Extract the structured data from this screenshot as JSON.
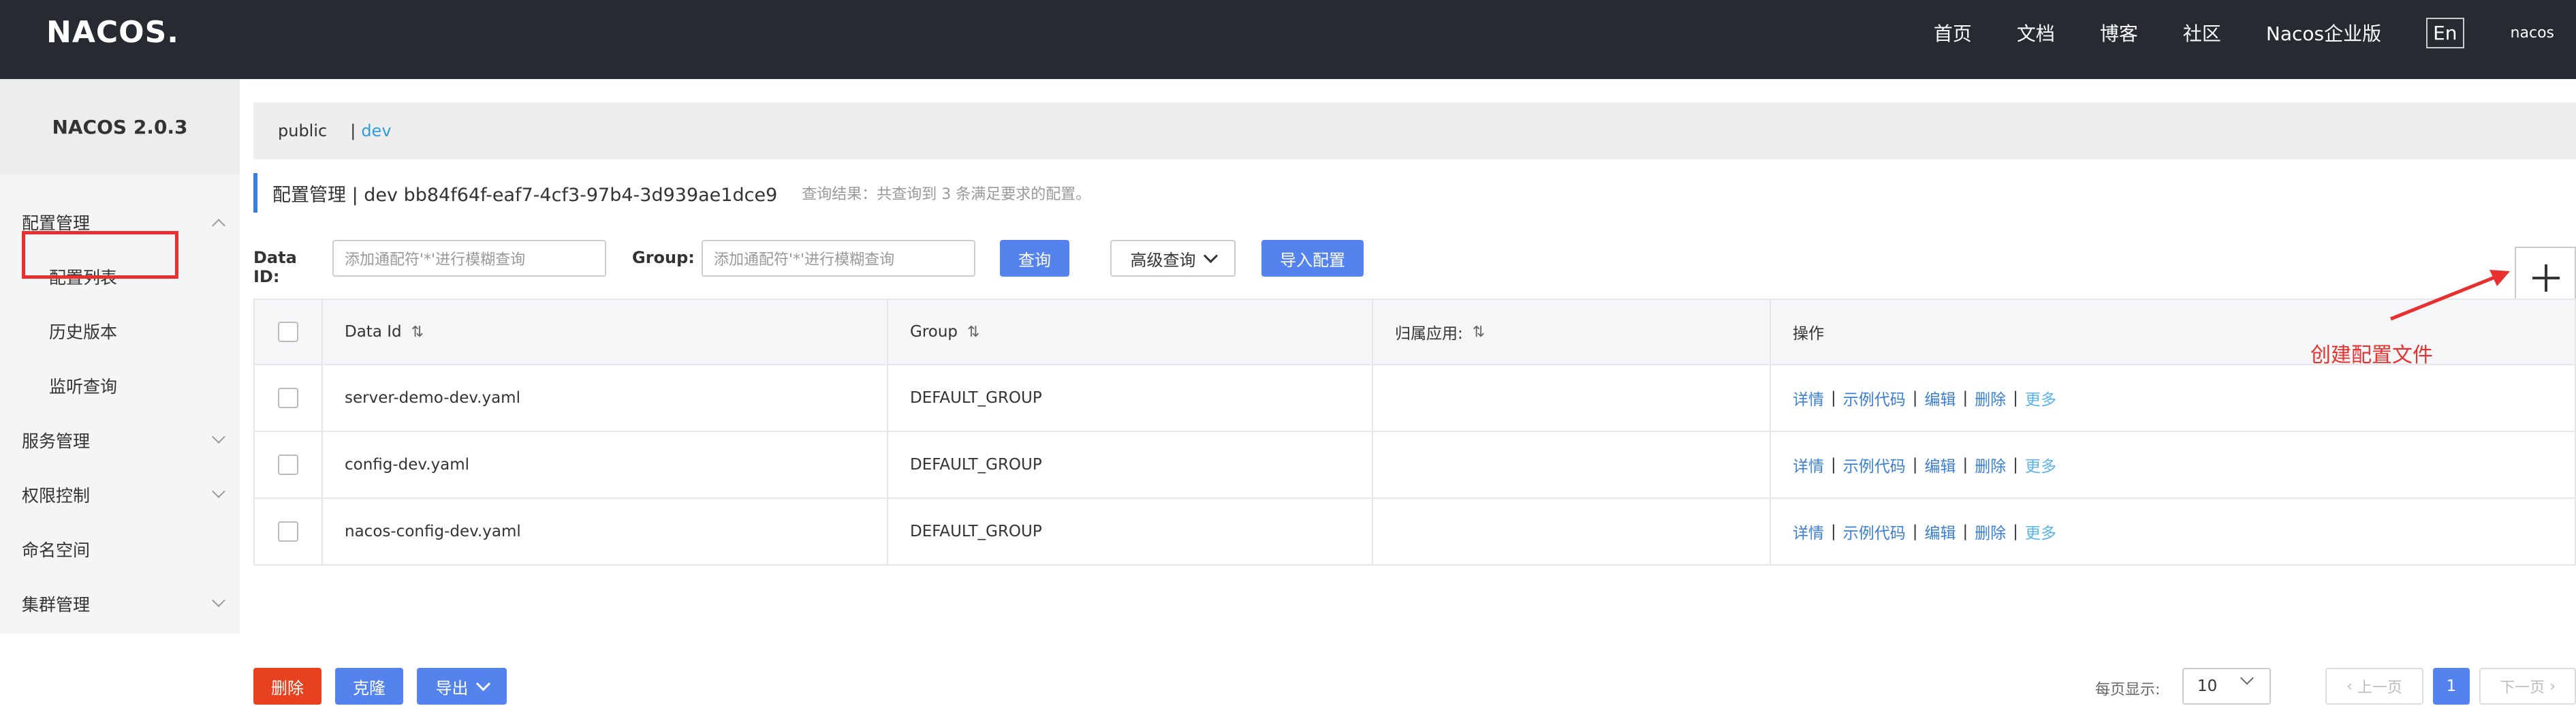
{
  "header": {
    "logo": "NACOS.",
    "nav": [
      "首页",
      "文档",
      "博客",
      "社区",
      "Nacos企业版"
    ],
    "lang": "En",
    "user": "nacos"
  },
  "sidebar": {
    "version": "NACOS 2.0.3",
    "items": [
      {
        "label": "配置管理"
      },
      {
        "label": "配置列表"
      },
      {
        "label": "历史版本"
      },
      {
        "label": "监听查询"
      },
      {
        "label": "服务管理"
      },
      {
        "label": "权限控制"
      },
      {
        "label": "命名空间"
      },
      {
        "label": "集群管理"
      }
    ]
  },
  "namespace": {
    "public": "public",
    "separator": "|",
    "current": "dev"
  },
  "page": {
    "title": "配置管理  |  dev  bb84f64f-eaf7-4cf3-97b4-3d939ae1dce9",
    "result_hint": "查询结果：共查询到 3 条满足要求的配置。"
  },
  "search": {
    "data_id_label": "Data ID:",
    "data_id_placeholder": "添加通配符'*'进行模糊查询",
    "group_label": "Group:",
    "group_placeholder": "添加通配符'*'进行模糊查询",
    "query_btn": "查询",
    "advanced_btn": "高级查询",
    "import_btn": "导入配置"
  },
  "annotation": {
    "text": "创建配置文件",
    "color": "#e8302f"
  },
  "table": {
    "headers": [
      "Data Id",
      "Group",
      "归属应用:",
      "操作"
    ],
    "sort_icon": "⇅",
    "rows": [
      {
        "data_id": "server-demo-dev.yaml",
        "group": "DEFAULT_GROUP",
        "app": ""
      },
      {
        "data_id": "config-dev.yaml",
        "group": "DEFAULT_GROUP",
        "app": ""
      },
      {
        "data_id": "nacos-config-dev.yaml",
        "group": "DEFAULT_GROUP",
        "app": ""
      }
    ],
    "ops": {
      "detail": "详情",
      "sample": "示例代码",
      "edit": "编辑",
      "delete": "删除",
      "more": "更多",
      "sep": "|"
    }
  },
  "footer": {
    "delete_btn": "删除",
    "clone_btn": "克隆",
    "export_btn": "导出",
    "page_size_label": "每页显示:",
    "page_size": "10",
    "prev": "上一页",
    "current_page": "1",
    "next": "下一页"
  },
  "colors": {
    "primary": "#5583ee",
    "danger": "#e8411f",
    "header_bg": "#262a31",
    "link": "#3a7fd4"
  }
}
